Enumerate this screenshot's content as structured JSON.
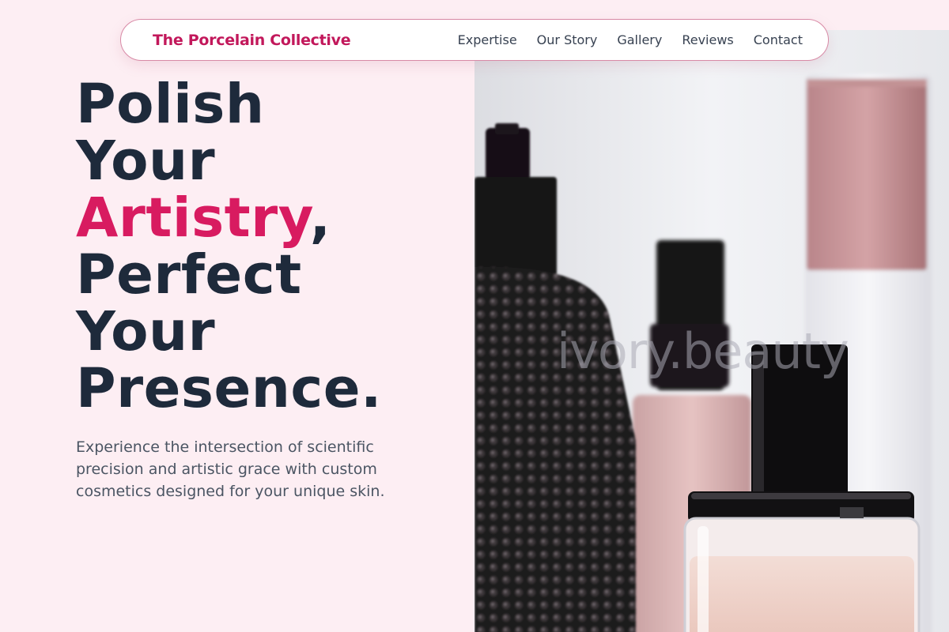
{
  "header": {
    "brand": "The Porcelain Collective",
    "nav": [
      "Expertise",
      "Our Story",
      "Gallery",
      "Reviews",
      "Contact"
    ]
  },
  "hero": {
    "headline": {
      "line1": "Polish",
      "line2": "Your",
      "line3_accent": "Artistry",
      "line3_punct": ",",
      "line4": "Perfect",
      "line5": "Your",
      "line6": "Presence."
    },
    "subcopy": "Experience the intersection of scientific precision and artistic grace with custom cosmetics designed for your unique skin.",
    "image": {
      "watermark": "ivory.beauty",
      "subject": "perfume-bottles"
    }
  },
  "colors": {
    "background": "#fdeef3",
    "brand": "#c2185b",
    "accent": "#d81b60",
    "heading": "#1e2a3b",
    "body_text": "#4b5563"
  }
}
